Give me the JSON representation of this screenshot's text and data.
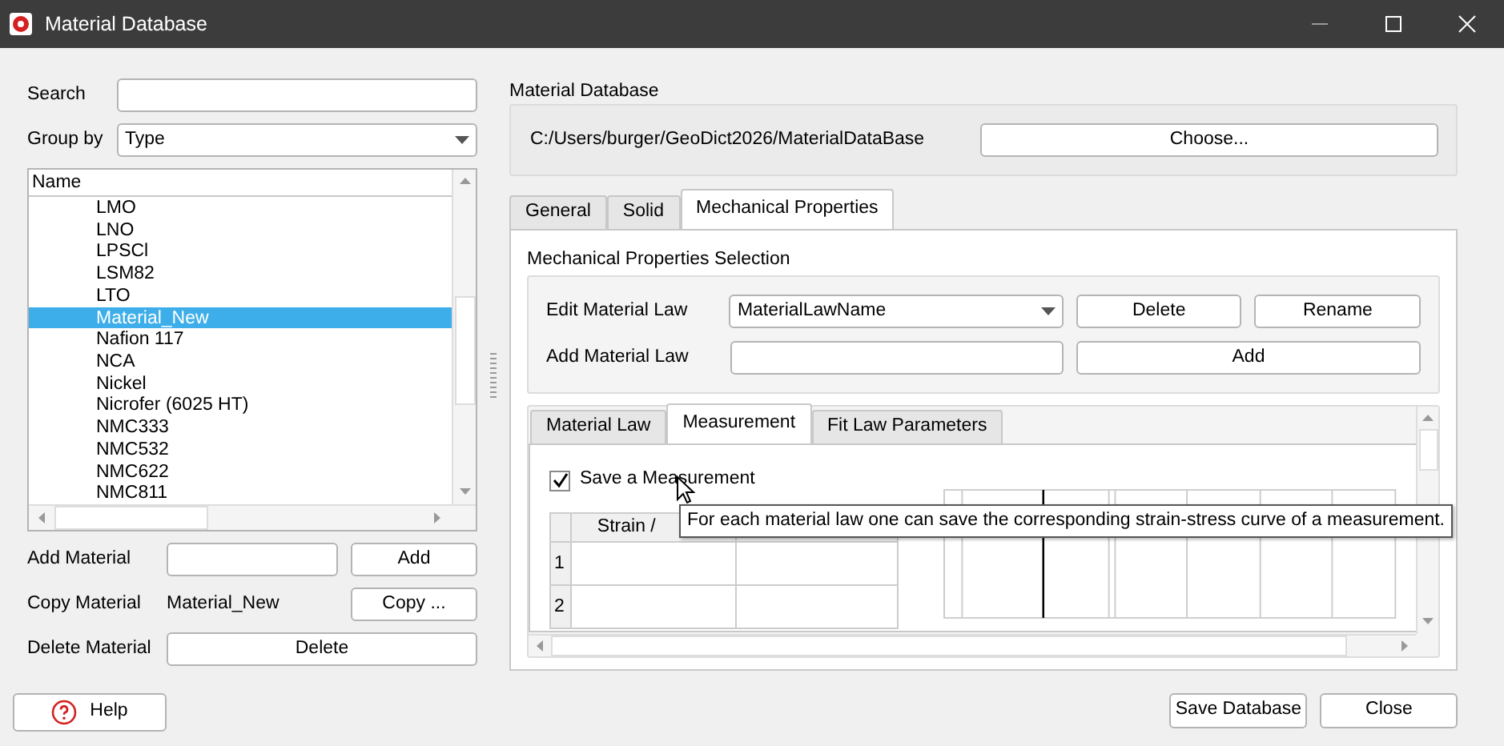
{
  "window": {
    "title": "Material Database"
  },
  "search": {
    "label": "Search"
  },
  "group_by": {
    "label": "Group by",
    "value": "Type"
  },
  "material_list": {
    "column": "Name",
    "items": [
      {
        "label": "LMO",
        "selected": false
      },
      {
        "label": "LNO",
        "selected": false
      },
      {
        "label": "LPSCl",
        "selected": false
      },
      {
        "label": "LSM82",
        "selected": false
      },
      {
        "label": "LTO",
        "selected": false
      },
      {
        "label": "Material_New",
        "selected": true
      },
      {
        "label": "Nafion 117",
        "selected": false
      },
      {
        "label": "NCA",
        "selected": false
      },
      {
        "label": "Nickel",
        "selected": false
      },
      {
        "label": "Nicrofer (6025 HT)",
        "selected": false
      },
      {
        "label": "NMC333",
        "selected": false
      },
      {
        "label": "NMC532",
        "selected": false
      },
      {
        "label": "NMC622",
        "selected": false
      },
      {
        "label": "NMC811",
        "selected": false
      }
    ]
  },
  "add_material": {
    "label": "Add Material",
    "button": "Add"
  },
  "copy_material": {
    "label": "Copy Material",
    "value": "Material_New",
    "button": "Copy ..."
  },
  "delete_material": {
    "label": "Delete Material",
    "button": "Delete"
  },
  "help_button": "Help",
  "database": {
    "title": "Material Database",
    "path": "C:/Users/burger/GeoDict2026/MaterialDataBase",
    "button": "Choose..."
  },
  "tabs": [
    {
      "label": "General",
      "selected": false
    },
    {
      "label": "Solid",
      "selected": false
    },
    {
      "label": "Mechanical Properties",
      "selected": true
    }
  ],
  "selection": {
    "title": "Mechanical Properties Selection",
    "edit_label": "Edit Material Law",
    "edit_value": "MaterialLawName",
    "delete_button": "Delete",
    "rename_button": "Rename",
    "add_label": "Add Material Law",
    "add_button": "Add"
  },
  "sub_tabs": [
    {
      "label": "Material Law",
      "selected": false
    },
    {
      "label": "Measurement",
      "selected": true
    },
    {
      "label": "Fit Law Parameters",
      "selected": false
    }
  ],
  "save_measurement": {
    "label": "Save a Measurement",
    "checked": true
  },
  "measurement_table": {
    "columns": [
      "Strain /"
    ],
    "rows": [
      "1",
      "2"
    ]
  },
  "tooltip": "For each material law one can save the corresponding strain-stress curve of a measurement.",
  "buttons": [
    "Save Database",
    "Close"
  ]
}
